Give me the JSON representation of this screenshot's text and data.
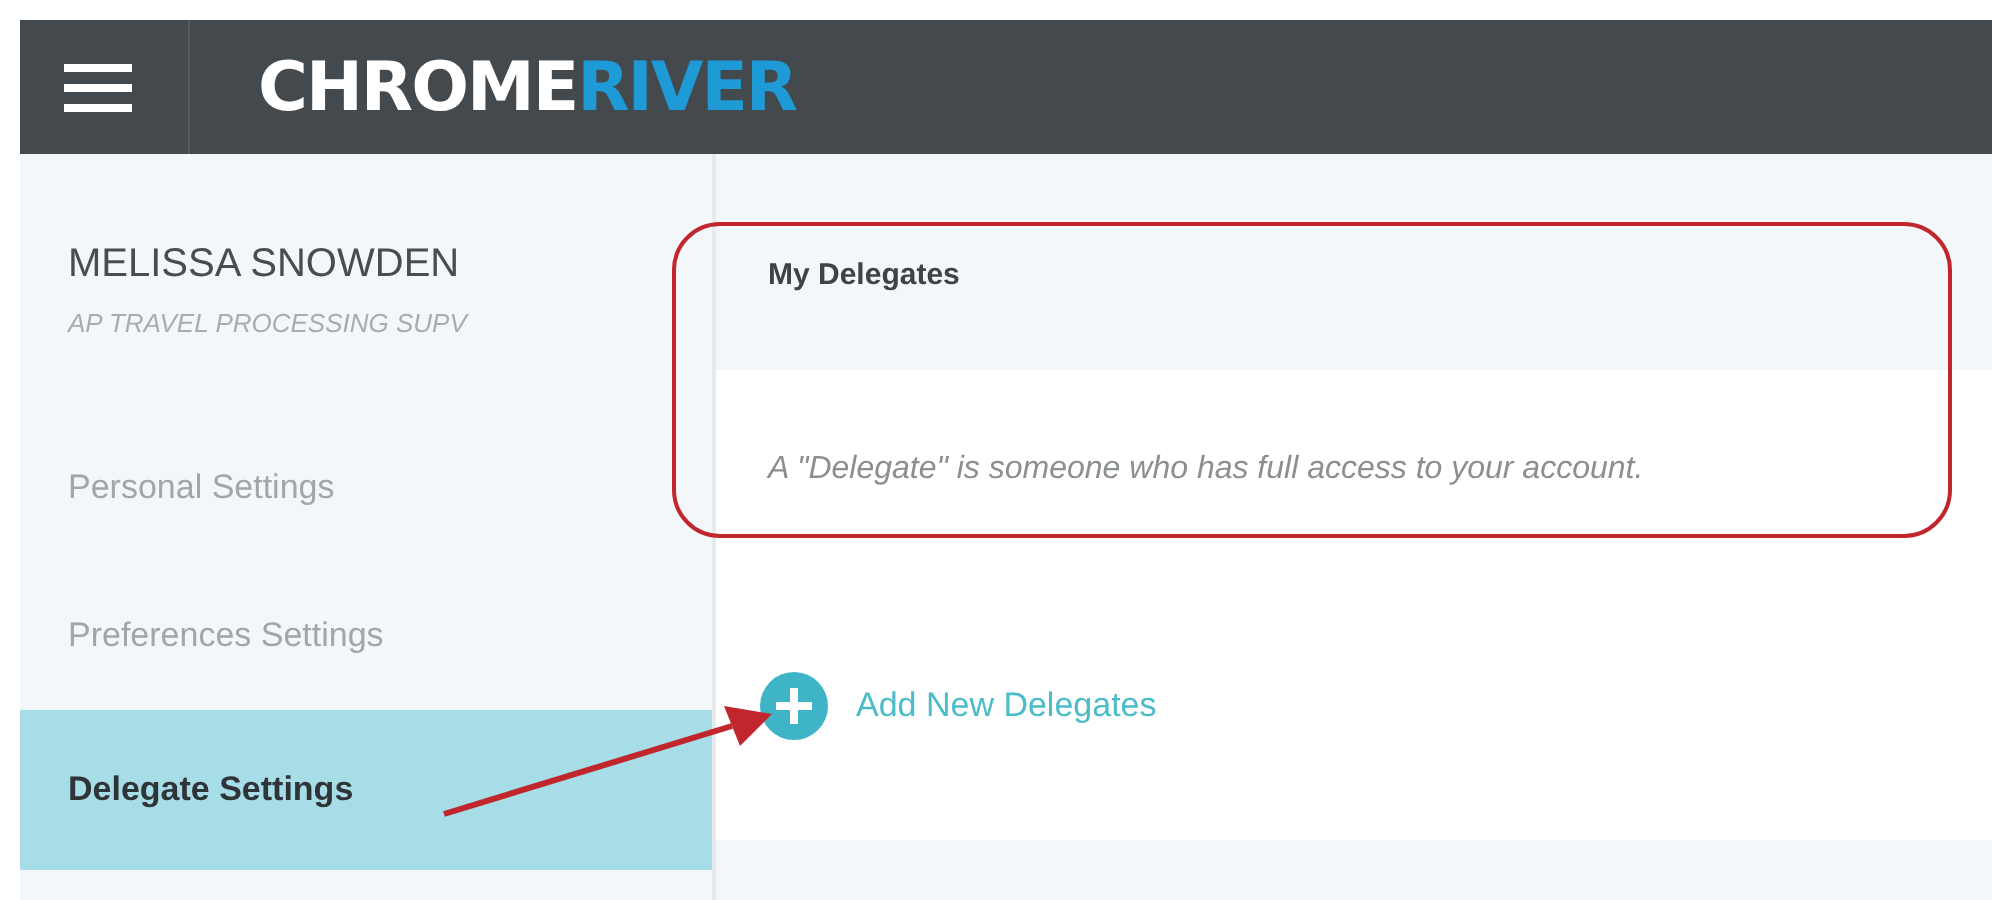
{
  "header": {
    "logo": [
      {
        "text": "CHROME",
        "color": "#ffffff"
      },
      {
        "text": "RIVER",
        "color": "#1e9ad6"
      }
    ]
  },
  "sidebar": {
    "user_name": "MELISSA SNOWDEN",
    "user_title": "AP TRAVEL PROCESSING SUPV",
    "items": [
      {
        "label": "Personal Settings",
        "selected": false
      },
      {
        "label": "Preferences Settings",
        "selected": false
      },
      {
        "label": "Delegate Settings",
        "selected": true
      }
    ]
  },
  "main": {
    "title": "My Delegates",
    "description": "A \"Delegate\" is someone who has full access to your account.",
    "add_link": "Add New Delegates"
  }
}
